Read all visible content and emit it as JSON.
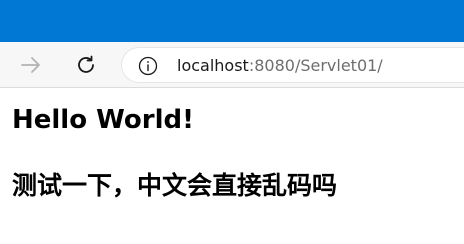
{
  "browser": {
    "accent_color": "#0078d4",
    "toolbar": {
      "forward_icon": "arrow-right-icon",
      "reload_icon": "reload-icon",
      "site_info_icon": "info-icon"
    },
    "address_bar": {
      "host": "localhost",
      "path": ":8080/Servlet01/"
    }
  },
  "page": {
    "heading": "Hello World!",
    "subheading": "测试一下，中文会直接乱码吗"
  }
}
